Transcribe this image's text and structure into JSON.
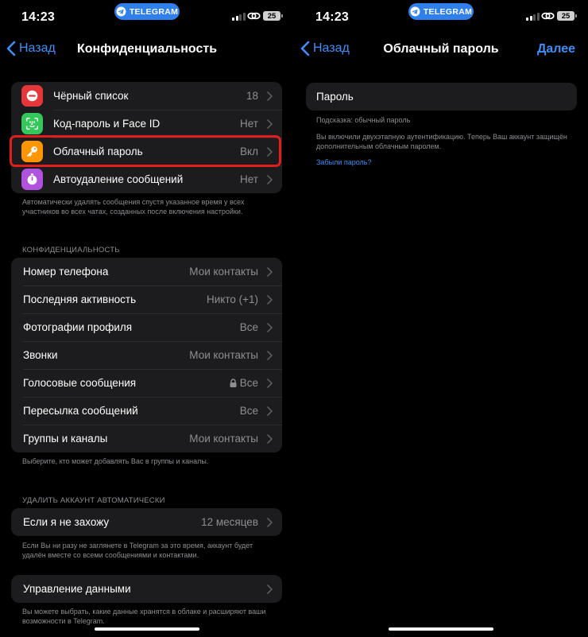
{
  "status": {
    "time": "14:23",
    "pill_label": "TELEGRAM",
    "battery": "25"
  },
  "left": {
    "nav": {
      "back_label": "Назад",
      "title": "Конфиденциальность"
    },
    "security_items": [
      {
        "label": "Чёрный список",
        "value": "18",
        "icon": "block-icon",
        "color": "#e5373a"
      },
      {
        "label": "Код-пароль и Face ID",
        "value": "Нет",
        "icon": "faceid-icon",
        "color": "#34c759"
      },
      {
        "label": "Облачный пароль",
        "value": "Вкл",
        "icon": "key-icon",
        "color": "#ff9500"
      },
      {
        "label": "Автоудаление сообщений",
        "value": "Нет",
        "icon": "timer-icon",
        "color": "#af52de"
      }
    ],
    "security_footer": "Автоматически удалять сообщения спустя указанное время у всех участников во всех чатах, созданных после включения настройки.",
    "privacy_header": "КОНФИДЕНЦИАЛЬНОСТЬ",
    "privacy_items": [
      {
        "label": "Номер телефона",
        "value": "Мои контакты"
      },
      {
        "label": "Последняя активность",
        "value": "Никто (+1)"
      },
      {
        "label": "Фотографии профиля",
        "value": "Все"
      },
      {
        "label": "Звонки",
        "value": "Мои контакты"
      },
      {
        "label": "Голосовые сообщения",
        "value": "Все",
        "locked": true
      },
      {
        "label": "Пересылка сообщений",
        "value": "Все"
      },
      {
        "label": "Группы и каналы",
        "value": "Мои контакты"
      }
    ],
    "privacy_footer": "Выберите, кто может добавлять Вас в группы и каналы.",
    "delete_header": "УДАЛИТЬ АККАУНТ АВТОМАТИЧЕСКИ",
    "delete_item": {
      "label": "Если я не захожу",
      "value": "12 месяцев"
    },
    "delete_footer": "Если Вы ни разу не заглянете в Telegram за это время, аккаунт будет удалён вместе со всеми сообщениями и контактами.",
    "data_item": {
      "label": "Управление данными"
    },
    "data_footer": "Вы можете выбрать, какие данные хранятся в облаке и расширяют ваши возможности в Telegram."
  },
  "right": {
    "nav": {
      "back_label": "Назад",
      "title": "Облачный пароль",
      "next_label": "Далее"
    },
    "password_label": "Пароль",
    "hint": "Подсказка: обычный пароль",
    "info": "Вы включили двухэтапную аутентификацию. Теперь Ваш аккаунт защищён дополнительным облачным паролем.",
    "forgot_label": "Забыли пароль?"
  },
  "colors": {
    "accent": "#3e8ef7",
    "highlight": "#e11d1d",
    "cell": "#1c1c1e"
  }
}
